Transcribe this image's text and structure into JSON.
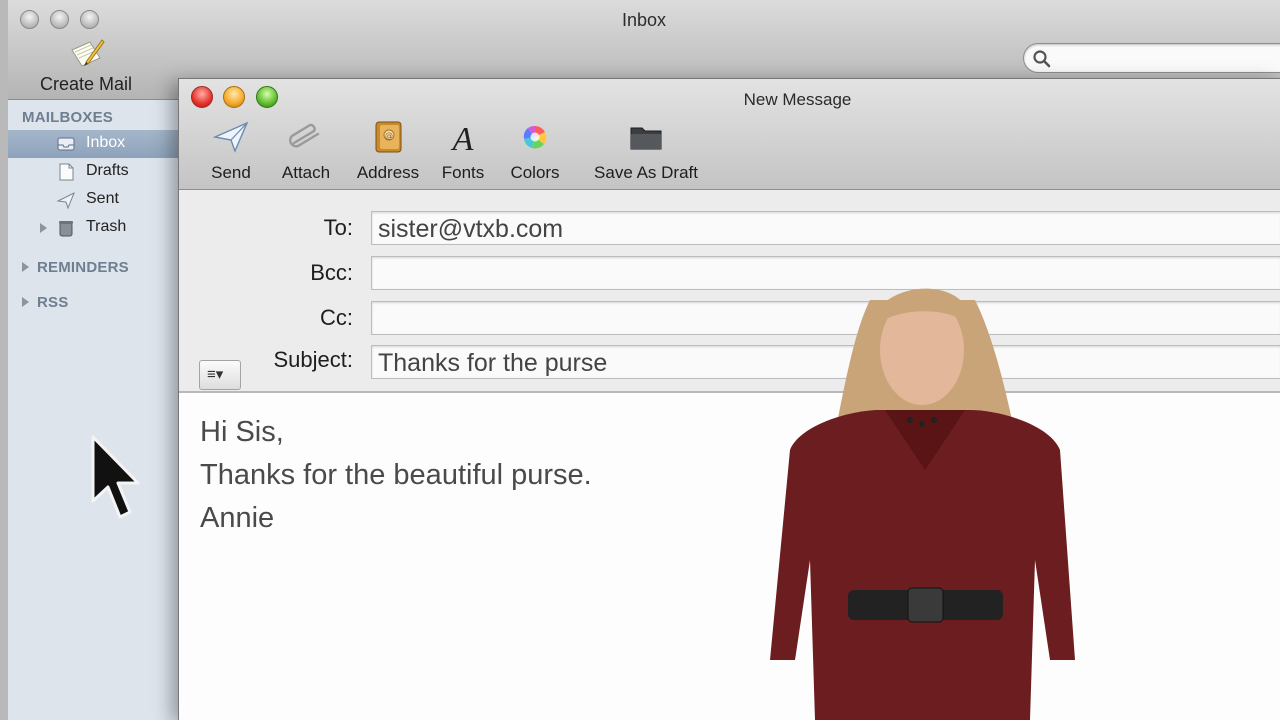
{
  "main_window": {
    "title": "Inbox",
    "create_mail_label": "Create Mail",
    "search": {
      "value": "",
      "placeholder": ""
    }
  },
  "sidebar": {
    "mailboxes_header": "MAILBOXES",
    "items": [
      {
        "label": "Inbox",
        "icon": "inbox-icon",
        "selected": true
      },
      {
        "label": "Drafts",
        "icon": "drafts-icon",
        "selected": false
      },
      {
        "label": "Sent",
        "icon": "sent-icon",
        "selected": false
      },
      {
        "label": "Trash",
        "icon": "trash-icon",
        "selected": false
      }
    ],
    "reminders_header": "REMINDERS",
    "rss_header": "RSS"
  },
  "compose": {
    "title": "New Message",
    "toolbar": [
      {
        "label": "Send",
        "icon": "send-icon"
      },
      {
        "label": "Attach",
        "icon": "paperclip-icon"
      },
      {
        "label": "Address",
        "icon": "address-book-icon"
      },
      {
        "label": "Fonts",
        "icon": "fonts-icon"
      },
      {
        "label": "Colors",
        "icon": "color-wheel-icon"
      },
      {
        "label": "Save As Draft",
        "icon": "folder-icon"
      }
    ],
    "fields": {
      "to_label": "To:",
      "to_value": "sister@vtxb.com",
      "bcc_label": "Bcc:",
      "bcc_value": "",
      "cc_label": "Cc:",
      "cc_value": "",
      "subject_label": "Subject:",
      "subject_value": "Thanks for the purse"
    },
    "header_menu_glyph": "≡▾",
    "body_lines": [
      "Hi Sis,",
      "Thanks for the beautiful purse.",
      "Annie"
    ]
  },
  "colors": {
    "sidebar_bg": "#dde4ec",
    "sidebar_selected": "#8da2ba",
    "close": "#e6312a",
    "minimize": "#f6a72a",
    "zoom": "#5fbb2e"
  }
}
